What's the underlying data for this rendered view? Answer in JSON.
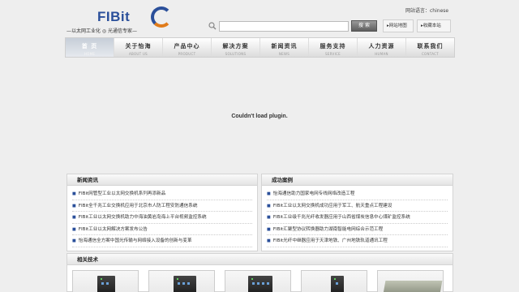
{
  "header": {
    "logo_text": "FIBit",
    "slogan": "—以太网工业化 ◎ 光通信专家—",
    "language_label": "网站语言：chinese",
    "search": {
      "value": "",
      "placeholder": "",
      "button_label": "搜 索"
    },
    "links": {
      "sitemap": "网站地图",
      "favorite": "收藏本站"
    }
  },
  "nav": [
    {
      "cn": "首 页",
      "en": "HOME",
      "active": true
    },
    {
      "cn": "关于怡海",
      "en": "ABOUT US"
    },
    {
      "cn": "产品中心",
      "en": "PRODUCT"
    },
    {
      "cn": "解决方案",
      "en": "SOLUTIONS"
    },
    {
      "cn": "新闻资讯",
      "en": "NEWS"
    },
    {
      "cn": "服务支持",
      "en": "SERVICE"
    },
    {
      "cn": "人力资源",
      "en": "HUMAN"
    },
    {
      "cn": "联系我们",
      "en": "CONTACT"
    }
  ],
  "plugin_message": "Couldn't load plugin.",
  "news": {
    "title": "新闻资讯",
    "items": [
      "FIBit网管型工业以太网交换机系列再添新品",
      "FIBit全千兆工业交换机应用于北京市人防工程安防通信系统",
      "FIBit工业以太网交换机助力中海油黄岩岛海上平台视频监控系统",
      "FIBit工业以太网解决方案发布公告",
      "怡海通信全方案中国光传输与网络接入设备的创新与变革"
    ]
  },
  "cases": {
    "title": "成功案例",
    "items": [
      "怡海通信助力国家电网专线网络改造工程",
      "FIBit工业以太网交换机成功应用于军工、航天重点工程建设",
      "FIBit工业级千兆光纤收发器应用于山西省煤炭信息中心煤矿监控系统",
      "FIBit汇聚型协议转换器助力湖南智能电网综合示范工程",
      "FIBit光纤中继器应用于天津地铁、广州地铁轨道通讯工程"
    ]
  },
  "related": {
    "title": "相关技术"
  },
  "colors": {
    "brand_blue": "#2a4f9a",
    "brand_orange": "#e07b1a"
  }
}
